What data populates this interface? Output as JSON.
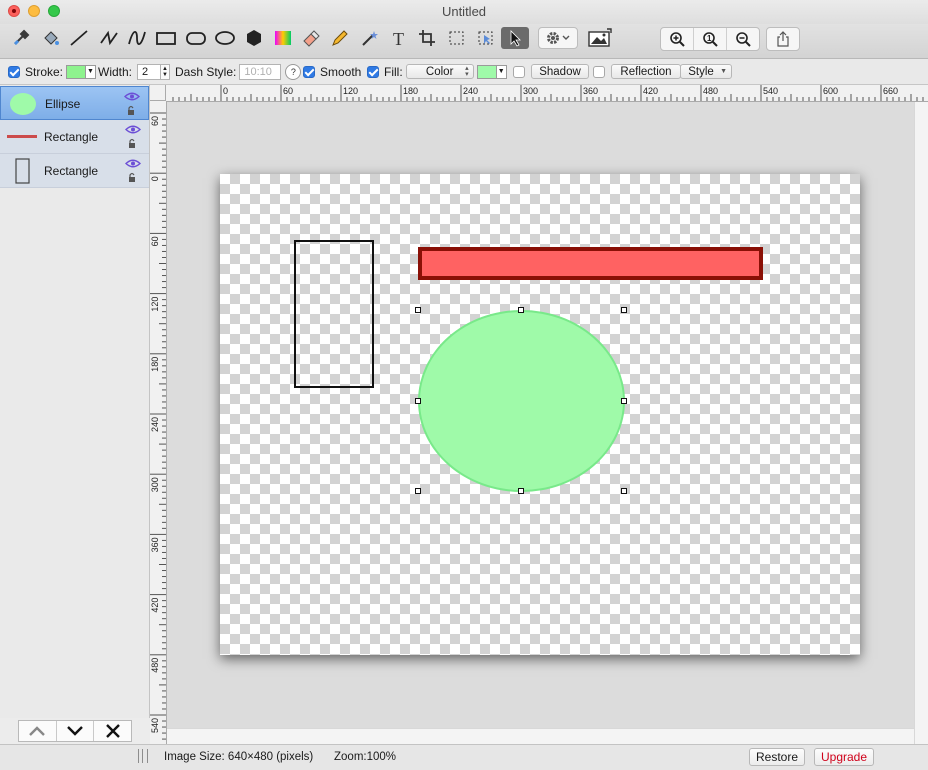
{
  "window": {
    "title": "Untitled"
  },
  "options_bar": {
    "stroke_label": "Stroke:",
    "width_label": "Width:",
    "width_value": "2",
    "dash_label": "Dash Style:",
    "dash_value": "10:10",
    "help_glyph": "?",
    "smooth_label": "Smooth",
    "fill_label": "Fill:",
    "fill_type": "Color",
    "shadow_label": "Shadow",
    "reflection_label": "Reflection",
    "style_label": "Style",
    "stroke_color": "#8ef38e",
    "fill_color": "#9ffaa9"
  },
  "layers": {
    "items": [
      {
        "name": "Ellipse",
        "selected": true
      },
      {
        "name": "Rectangle",
        "selected": false
      },
      {
        "name": "Rectangle",
        "selected": false
      }
    ]
  },
  "ruler": {
    "h_labels": [
      "0",
      "60",
      "120",
      "180",
      "240",
      "300",
      "360",
      "420",
      "480",
      "540",
      "600",
      "660"
    ],
    "v_labels": [
      "60",
      "0",
      "60",
      "120",
      "180",
      "240",
      "300",
      "360",
      "420",
      "480",
      "540"
    ]
  },
  "status": {
    "image_size": "Image Size: 640×480 (pixels)",
    "zoom": "Zoom:100%",
    "restore": "Restore",
    "upgrade": "Upgrade"
  },
  "colors": {
    "selection": "#7eaee8",
    "bar_fill": "#ff6262",
    "bar_stroke": "#8a1006",
    "ellipse_fill": "#9ffaa9",
    "upgrade_text": "#d0021b"
  }
}
